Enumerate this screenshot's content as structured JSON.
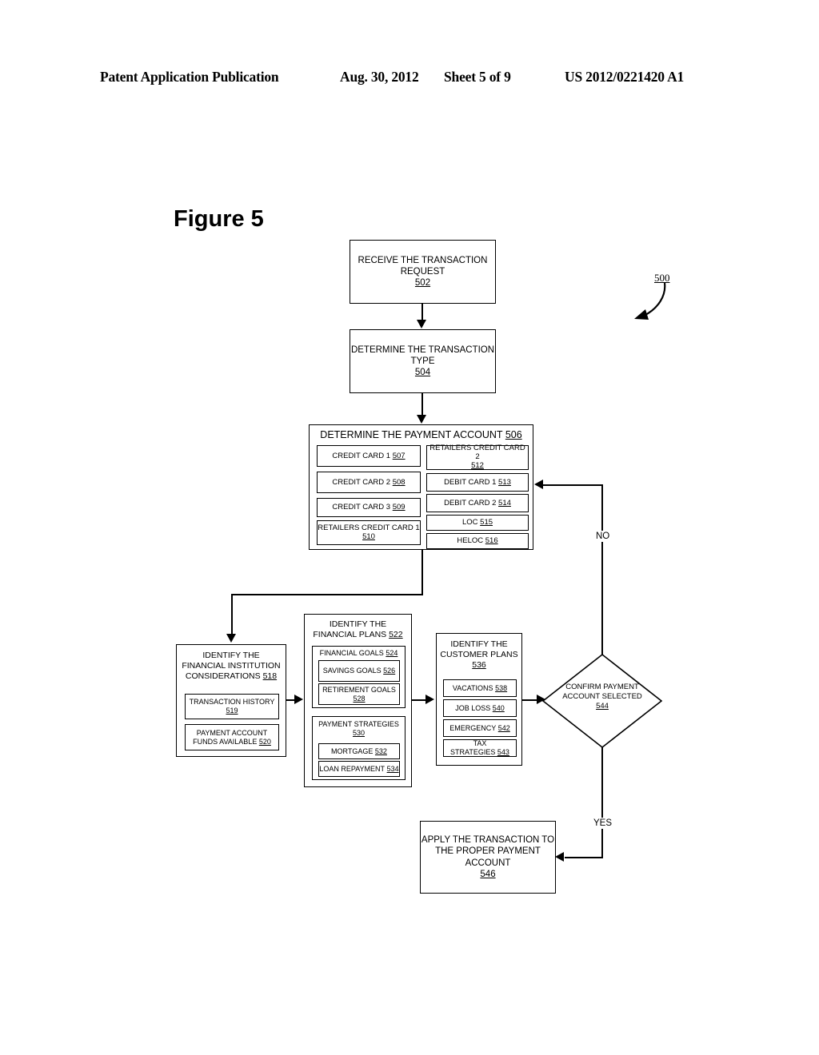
{
  "header": {
    "publication": "Patent Application Publication",
    "date": "Aug. 30, 2012",
    "sheet": "Sheet 5 of 9",
    "number": "US 2012/0221420 A1"
  },
  "figure": {
    "title": "Figure 5",
    "diagram_ref": "500"
  },
  "nodes": {
    "n502": {
      "line1": "RECEIVE THE TRANSACTION",
      "line2": "REQUEST",
      "ref": "502"
    },
    "n504": {
      "line1": "DETERMINE THE TRANSACTION",
      "line2": "TYPE",
      "ref": "504"
    },
    "n506": {
      "title": "DETERMINE THE PAYMENT ACCOUNT",
      "ref": "506"
    },
    "n507": {
      "label": "CREDIT CARD 1",
      "ref": "507"
    },
    "n508": {
      "label": "CREDIT CARD 2",
      "ref": "508"
    },
    "n509": {
      "label": "CREDIT CARD 3",
      "ref": "509"
    },
    "n510": {
      "label": "RETAILERS CREDIT CARD 1",
      "ref": "510"
    },
    "n512": {
      "label": "RETAILERS CREDIT CARD 2",
      "ref": "512"
    },
    "n513": {
      "label": "DEBIT CARD 1",
      "ref": "513"
    },
    "n514": {
      "label": "DEBIT CARD 2",
      "ref": "514"
    },
    "n515": {
      "label": "LOC",
      "ref": "515"
    },
    "n516": {
      "label": "HELOC",
      "ref": "516"
    },
    "n518": {
      "line1": "IDENTIFY THE",
      "line2": "FINANCIAL INSTITUTION",
      "line3": "CONSIDERATIONS",
      "ref": "518"
    },
    "n519": {
      "label": "TRANSACTION HISTORY",
      "ref": "519"
    },
    "n520": {
      "line1": "PAYMENT ACCOUNT",
      "line2": "FUNDS AVAILABLE",
      "ref": "520"
    },
    "n522": {
      "line1": "IDENTIFY THE",
      "line2": "FINANCIAL PLANS",
      "ref": "522"
    },
    "n524": {
      "label": "FINANCIAL GOALS",
      "ref": "524"
    },
    "n526": {
      "label": "SAVINGS GOALS",
      "ref": "526"
    },
    "n528": {
      "label": "RETIREMENT GOALS",
      "ref": "528"
    },
    "n530": {
      "label": "PAYMENT STRATEGIES",
      "ref": "530"
    },
    "n532": {
      "label": "MORTGAGE",
      "ref": "532"
    },
    "n534": {
      "label": "LOAN REPAYMENT",
      "ref": "534"
    },
    "n536": {
      "line1": "IDENTIFY THE",
      "line2": "CUSTOMER PLANS",
      "ref": "536"
    },
    "n538": {
      "label": "VACATIONS",
      "ref": "538"
    },
    "n540": {
      "label": "JOB LOSS",
      "ref": "540"
    },
    "n542": {
      "label": "EMERGENCY",
      "ref": "542"
    },
    "n543": {
      "label": "TAX STRATEGIES",
      "ref": "543"
    },
    "n544": {
      "line1": "CONFIRM PAYMENT",
      "line2": "ACCOUNT SELECTED",
      "ref": "544"
    },
    "n546": {
      "line1": "APPLY THE TRANSACTION TO",
      "line2": "THE PROPER PAYMENT",
      "line3": "ACCOUNT",
      "ref": "546"
    }
  },
  "edges": {
    "no_label": "NO",
    "yes_label": "YES"
  }
}
